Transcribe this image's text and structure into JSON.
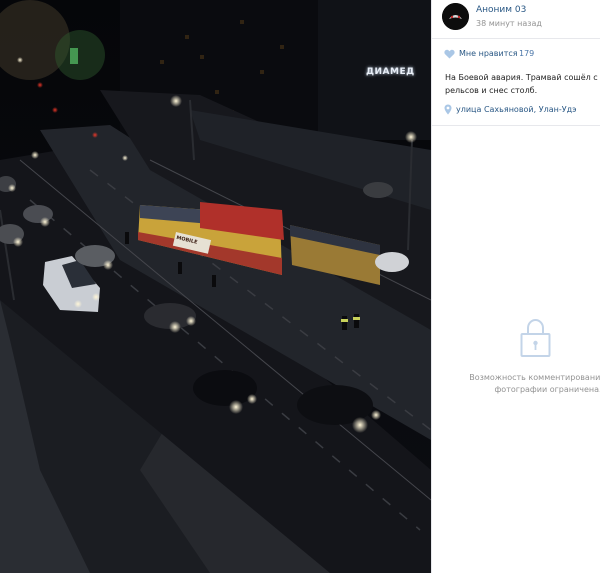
{
  "photo": {
    "sign_text": "ДИАМЕД",
    "tram_ad_text": "MOBILE"
  },
  "post": {
    "author_name": "Аноним 03",
    "time_ago": "38 минут назад",
    "like_label": "Мне нравится",
    "like_count": "179",
    "caption": "На Боевой авария. Трамвай сошёл с рельсов и снес столб.",
    "location": "улица Сахьяновой, Улан-Удэ"
  },
  "comments": {
    "restricted_message": "Возможность комментирования этой фотографии ограничена."
  },
  "colors": {
    "link": "#2a5885",
    "muted": "#939393",
    "icon": "#aac7e6"
  },
  "icons": [
    "heart-icon",
    "location-pin-icon",
    "lock-icon"
  ]
}
